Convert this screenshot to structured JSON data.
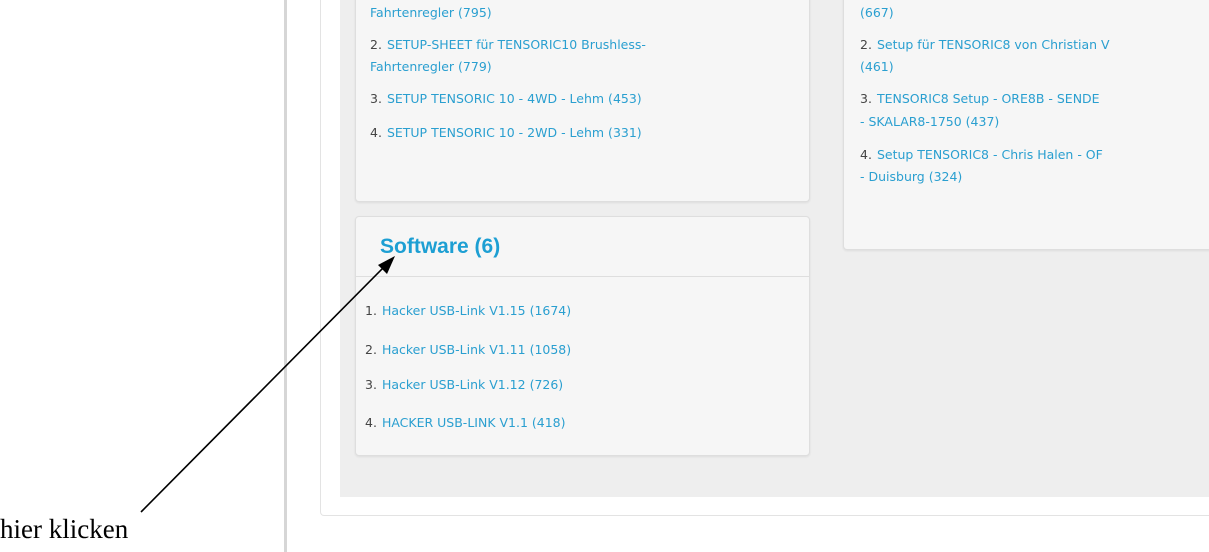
{
  "top_left_card": {
    "items": [
      {
        "num": "",
        "line1": "Fahrtenregler (795)",
        "line2": ""
      },
      {
        "num": "2.",
        "line1": "SETUP-SHEET für TENSORIC10 Brushless-",
        "line2": "Fahrtenregler (779)"
      },
      {
        "num": "3.",
        "line1": "SETUP TENSORIC 10 - 4WD - Lehm (453)",
        "line2": ""
      },
      {
        "num": "4.",
        "line1": "SETUP TENSORIC 10 - 2WD - Lehm (331)",
        "line2": ""
      }
    ]
  },
  "top_right_card": {
    "items": [
      {
        "num": "",
        "line1": "(667)",
        "line2": ""
      },
      {
        "num": "2.",
        "line1": "Setup für TENSORIC8 von Christian V",
        "line2": "(461)"
      },
      {
        "num": "3.",
        "line1": "TENSORIC8 Setup - ORE8B - SENDE",
        "line2": "- SKALAR8-1750 (437)"
      },
      {
        "num": "4.",
        "line1": "Setup TENSORIC8 - Chris Halen - OF",
        "line2": "- Duisburg (324)"
      }
    ]
  },
  "software_card": {
    "title": "Software (6)",
    "items": [
      {
        "num": "1.",
        "label": "Hacker USB-Link V1.15 (1674)"
      },
      {
        "num": "2.",
        "label": "Hacker USB-Link V1.11 (1058)"
      },
      {
        "num": "3.",
        "label": "Hacker USB-Link V1.12 (726)"
      },
      {
        "num": "4.",
        "label": "HACKER USB-LINK V1.1 (418)"
      }
    ]
  },
  "annotation": {
    "text": "hier klicken",
    "arrow_icon": "arrow-icon"
  }
}
